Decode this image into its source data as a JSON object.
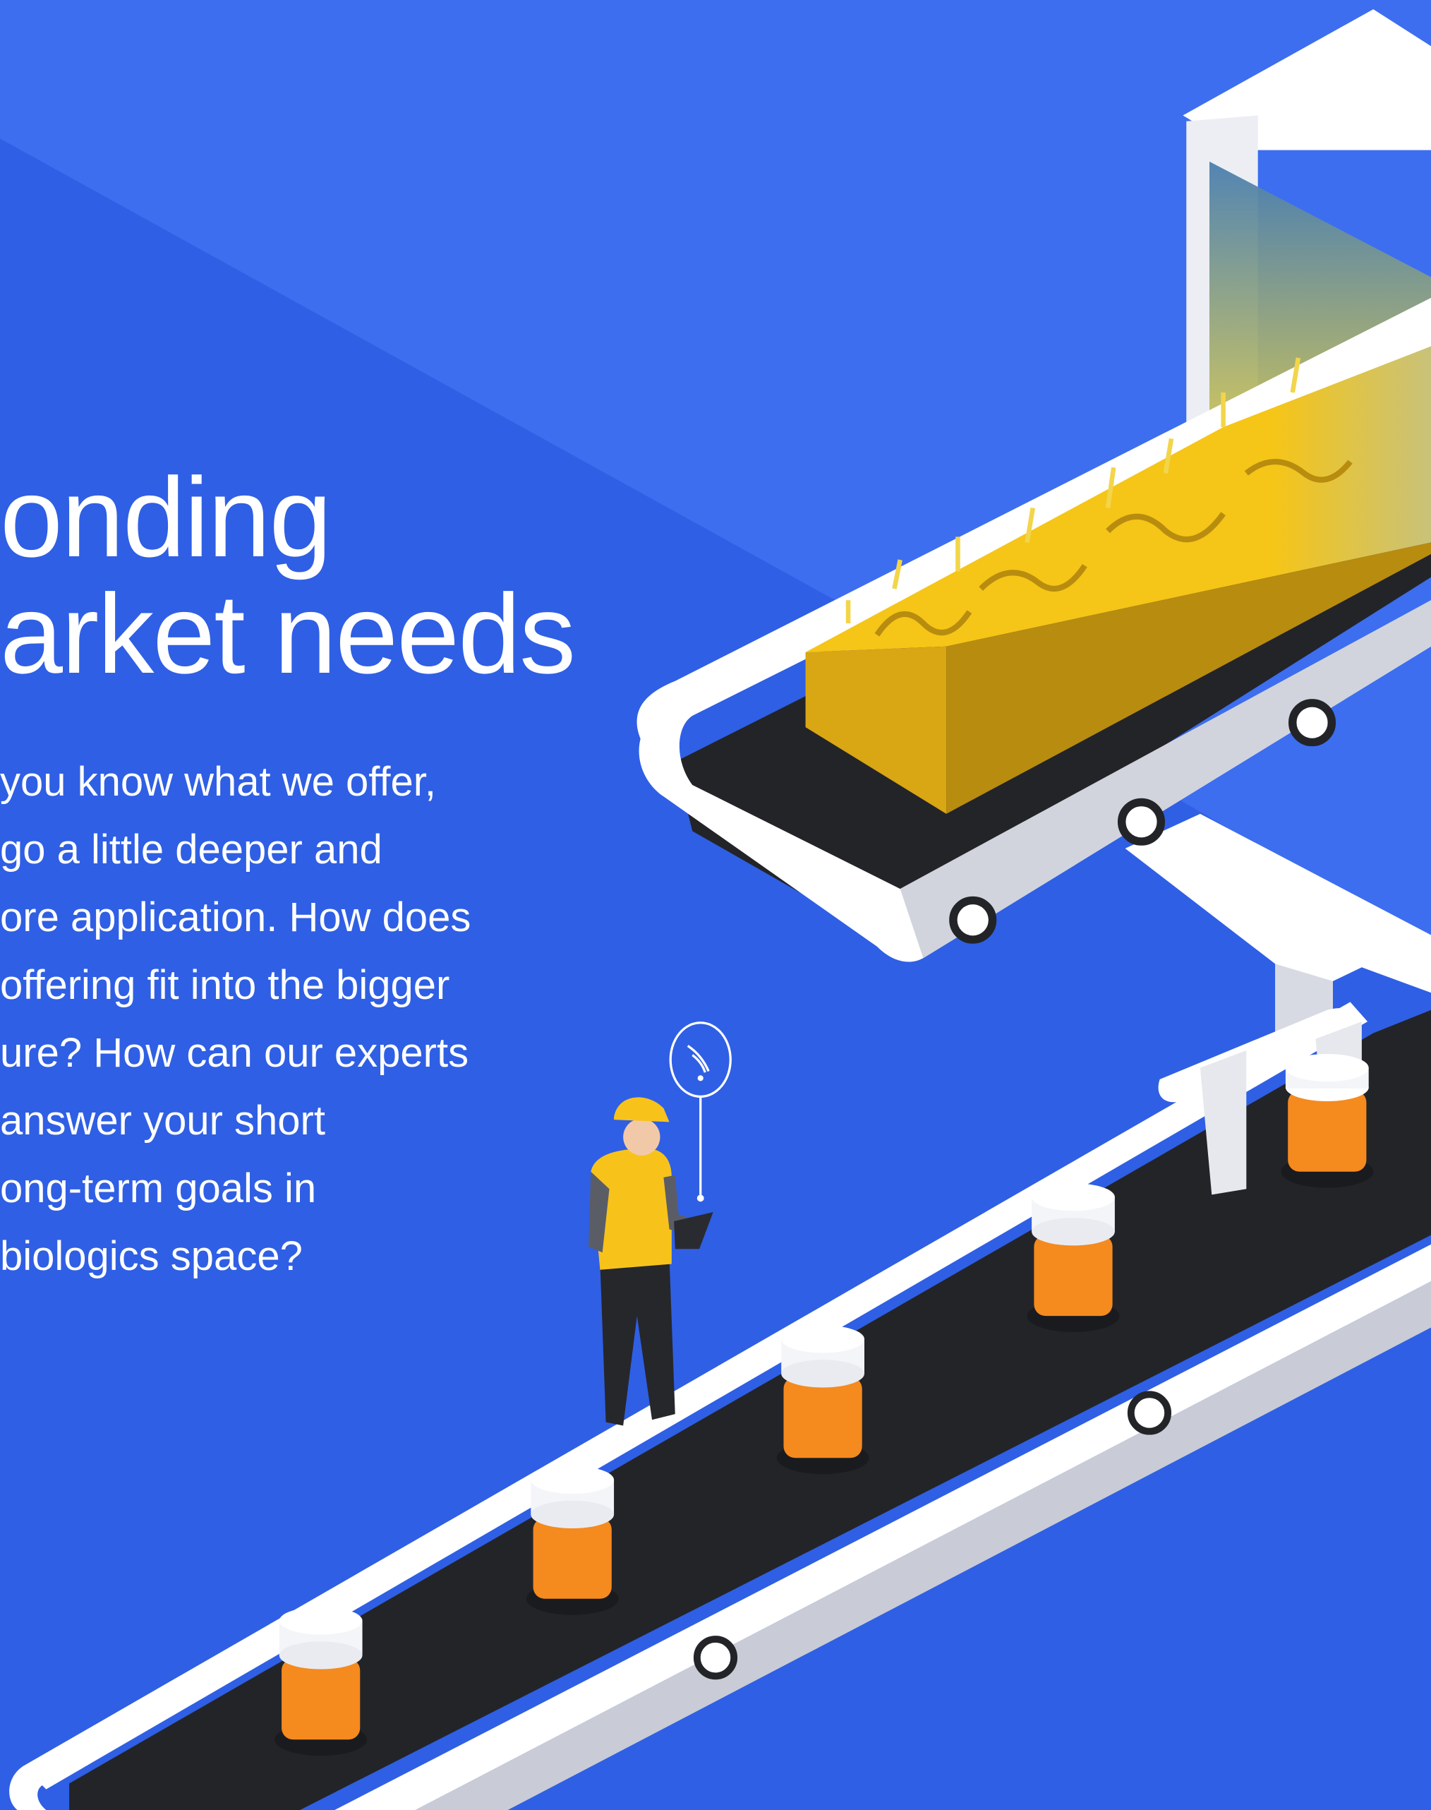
{
  "headline": {
    "line1": "onding",
    "line2": "arket needs"
  },
  "body": {
    "lines": [
      "you know what we offer,",
      "go a little deeper and",
      "ore application. How does",
      "offering fit into the bigger",
      "ure? How can our experts",
      "answer your short",
      "ong-term goals in",
      "biologics space?"
    ]
  },
  "colors": {
    "background": "#3d6ef0",
    "background_shade": "#2f5fe4",
    "belt": "#232428",
    "rail": "#ffffff",
    "cheese": "#f2be1c",
    "jar_orange": "#f58a1f",
    "hard_hat": "#f7c31b"
  },
  "illustration": {
    "subject": "isometric-production-line",
    "icons": [
      "wifi-signal-icon",
      "tablet-icon",
      "hard-hat-icon"
    ]
  }
}
